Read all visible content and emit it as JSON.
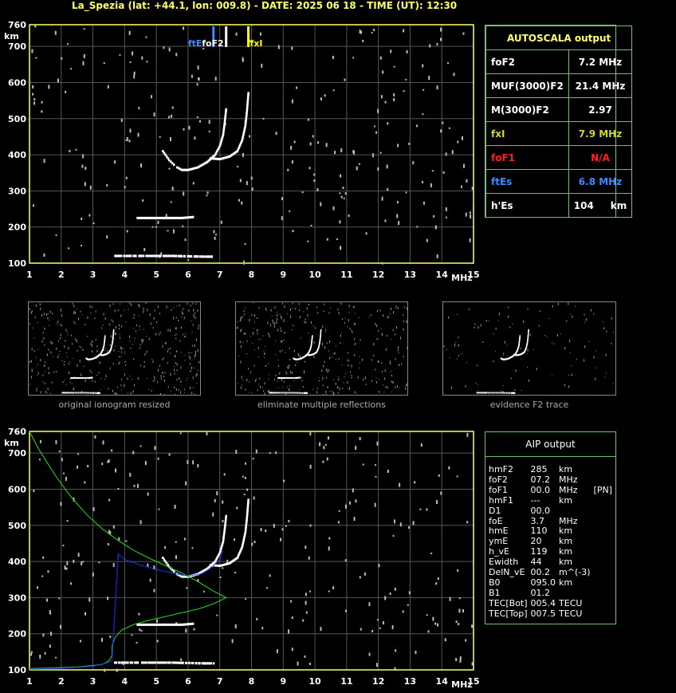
{
  "header": {
    "title": "La_Spezia (lat: +44.1, lon: 009.8) - DATE: 2025 06 18 - TIME (UT): 12:30"
  },
  "autoscala": {
    "title": "AUTOSCALA output",
    "rows": [
      {
        "label": "foF2",
        "value": "7.2 MHz",
        "color": "#ffffff"
      },
      {
        "label": "MUF(3000)F2",
        "value": "21.4 MHz",
        "color": "#ffffff"
      },
      {
        "label": "M(3000)F2",
        "value": "2.97",
        "color": "#ffffff"
      },
      {
        "label": "fxI",
        "value": "7.9 MHz",
        "color": "#d4d43a"
      },
      {
        "label": "foF1",
        "value": "N/A",
        "color": "#ff2020"
      },
      {
        "label": "ftEs",
        "value": "6.8 MHz",
        "color": "#3d8bff"
      },
      {
        "label": "h'Es",
        "value": "104     km",
        "color": "#ffffff"
      }
    ]
  },
  "aip": {
    "title": "AIP output",
    "rows": [
      [
        "hmF2",
        "285",
        "km",
        ""
      ],
      [
        "foF2",
        "07.2",
        "MHz",
        ""
      ],
      [
        "foF1",
        "00.0",
        "MHz",
        "[PN]"
      ],
      [
        "hmF1",
        "---",
        "km",
        ""
      ],
      [
        "D1",
        "00.0",
        "",
        ""
      ],
      [
        "foE",
        "3.7",
        "MHz",
        ""
      ],
      [
        "hmE",
        "110",
        "km",
        ""
      ],
      [
        "ymE",
        "20",
        "km",
        ""
      ],
      [
        "h_vE",
        "119",
        "km",
        ""
      ],
      [
        "Ewidth",
        "44",
        "km",
        ""
      ],
      [
        "DelN_vE",
        "00.2",
        "m^(-3)",
        ""
      ],
      [
        "B0",
        "095.0",
        "km",
        ""
      ],
      [
        "B1",
        "01.2",
        "",
        ""
      ],
      [
        "TEC[Bot]",
        "005.4",
        "TECU",
        ""
      ],
      [
        "TEC[Top]",
        "007.5",
        "TECU",
        ""
      ]
    ]
  },
  "captions": {
    "original": "original ionogram resized",
    "eliminate": "eliminate multiple reflections",
    "evidence": "evidence F2 trace"
  },
  "markers": {
    "ftE": "ftE",
    "foF2": "foF2",
    "fxI": "fxI"
  },
  "chart_data": [
    {
      "type": "scatter",
      "title": "",
      "xunit": "MHz",
      "yunit": "km",
      "xlim": [
        1,
        15
      ],
      "ylim": [
        100,
        760
      ],
      "xticks": [
        1,
        2,
        3,
        4,
        5,
        6,
        7,
        8,
        9,
        10,
        11,
        12,
        13,
        14,
        15
      ],
      "yticks": [
        100,
        200,
        300,
        400,
        500,
        600,
        700,
        760
      ],
      "vertical_markers": [
        {
          "name": "ftE",
          "x": 6.8,
          "color": "#3d8bff"
        },
        {
          "name": "foF2",
          "x": 7.2,
          "color": "#ffffff"
        },
        {
          "name": "fxI",
          "x": 7.9,
          "color": "#ffff00"
        }
      ],
      "traces": {
        "o_trace": [
          [
            5.65,
            365
          ],
          [
            5.8,
            358
          ],
          [
            6.0,
            358
          ],
          [
            6.3,
            365
          ],
          [
            6.6,
            380
          ],
          [
            6.85,
            400
          ],
          [
            7.0,
            425
          ],
          [
            7.1,
            455
          ],
          [
            7.15,
            490
          ],
          [
            7.2,
            530
          ]
        ],
        "x_trace": [
          [
            6.7,
            390
          ],
          [
            7.0,
            388
          ],
          [
            7.3,
            395
          ],
          [
            7.55,
            410
          ],
          [
            7.7,
            440
          ],
          [
            7.8,
            480
          ],
          [
            7.85,
            520
          ],
          [
            7.9,
            575
          ]
        ],
        "o_trace_tail": [
          [
            5.2,
            410
          ],
          [
            5.4,
            385
          ],
          [
            5.6,
            368
          ]
        ],
        "es_layer": [
          [
            3.7,
            120
          ],
          [
            4.5,
            120
          ],
          [
            5.5,
            120
          ],
          [
            6.5,
            118
          ],
          [
            6.8,
            118
          ]
        ],
        "es_second": [
          [
            4.4,
            225
          ],
          [
            5.0,
            225
          ],
          [
            5.8,
            225
          ],
          [
            6.2,
            228
          ]
        ]
      }
    },
    {
      "type": "line",
      "title": "",
      "xunit": "MHz",
      "yunit": "km",
      "xlim": [
        1,
        15
      ],
      "ylim": [
        100,
        760
      ],
      "xticks": [
        1,
        2,
        3,
        4,
        5,
        6,
        7,
        8,
        9,
        10,
        11,
        12,
        13,
        14,
        15
      ],
      "yticks": [
        100,
        200,
        300,
        400,
        500,
        600,
        700,
        760
      ],
      "series": [
        {
          "color": "#22dd22",
          "points": [
            [
              1.0,
              760
            ],
            [
              1.3,
              710
            ],
            [
              1.8,
              640
            ],
            [
              2.3,
              580
            ],
            [
              2.8,
              530
            ],
            [
              3.3,
              490
            ],
            [
              3.8,
              458
            ],
            [
              4.3,
              430
            ],
            [
              4.8,
              408
            ],
            [
              5.3,
              388
            ],
            [
              5.8,
              368
            ],
            [
              6.3,
              345
            ],
            [
              6.8,
              318
            ],
            [
              7.2,
              300
            ],
            [
              6.8,
              283
            ],
            [
              6.3,
              268
            ],
            [
              5.8,
              258
            ],
            [
              5.3,
              248
            ],
            [
              4.8,
              238
            ],
            [
              4.3,
              226
            ],
            [
              3.9,
              210
            ],
            [
              3.7,
              190
            ],
            [
              3.6,
              165
            ],
            [
              3.6,
              140
            ],
            [
              3.5,
              125
            ],
            [
              3.3,
              115
            ],
            [
              2.5,
              108
            ],
            [
              1.5,
              105
            ],
            [
              1.0,
              104
            ]
          ]
        },
        {
          "color": "#2233ff",
          "points": [
            [
              1.0,
              102
            ],
            [
              2.0,
              104
            ],
            [
              3.0,
              110
            ],
            [
              3.4,
              118
            ],
            [
              3.6,
              125
            ],
            [
              3.8,
              420
            ],
            [
              4.0,
              405
            ],
            [
              4.5,
              390
            ],
            [
              5.0,
              378
            ],
            [
              5.5,
              368
            ],
            [
              6.0,
              360
            ],
            [
              6.4,
              365
            ],
            [
              6.7,
              380
            ],
            [
              7.0,
              405
            ],
            [
              7.1,
              430
            ]
          ]
        }
      ]
    }
  ]
}
